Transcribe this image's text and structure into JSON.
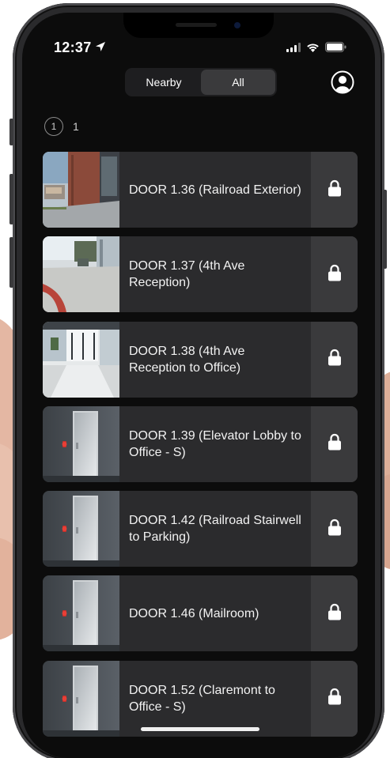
{
  "status_bar": {
    "time": "12:37",
    "location_icon": "location-arrow-icon",
    "signal_icon": "cellular-signal-icon",
    "wifi_icon": "wifi-icon",
    "battery_icon": "battery-icon"
  },
  "header": {
    "tabs": [
      {
        "label": "Nearby",
        "selected": false
      },
      {
        "label": "All",
        "selected": true
      }
    ],
    "profile_icon": "user-profile-icon"
  },
  "pagination": {
    "circle_label": "1",
    "page_label": "1"
  },
  "doors": [
    {
      "name": "DOOR 1.36 (Railroad Exterior)",
      "thumbnail": "camera-exterior-street",
      "state": "locked",
      "lock_icon": "lock-icon"
    },
    {
      "name": "DOOR 1.37 (4th Ave Reception)",
      "thumbnail": "camera-sidewalk",
      "state": "locked",
      "lock_icon": "lock-icon"
    },
    {
      "name": "DOOR 1.38 (4th Ave Reception to Office)",
      "thumbnail": "camera-reception-lobby",
      "state": "locked",
      "lock_icon": "lock-icon"
    },
    {
      "name": "DOOR 1.39 (Elevator Lobby to Office - S)",
      "thumbnail": "placeholder-glass-door",
      "state": "locked",
      "lock_icon": "lock-icon"
    },
    {
      "name": "DOOR 1.42 (Railroad Stairwell to Parking)",
      "thumbnail": "placeholder-glass-door",
      "state": "locked",
      "lock_icon": "lock-icon"
    },
    {
      "name": "DOOR 1.46 (Mailroom)",
      "thumbnail": "placeholder-glass-door",
      "state": "locked",
      "lock_icon": "lock-icon"
    },
    {
      "name": "DOOR 1.52 (Claremont to Office - S)",
      "thumbnail": "placeholder-glass-door",
      "state": "locked",
      "lock_icon": "lock-icon"
    }
  ],
  "colors": {
    "background": "#0c0c0c",
    "card": "#2b2b2d",
    "lock_button": "#3a3a3c",
    "text": "#f2f2f2"
  }
}
